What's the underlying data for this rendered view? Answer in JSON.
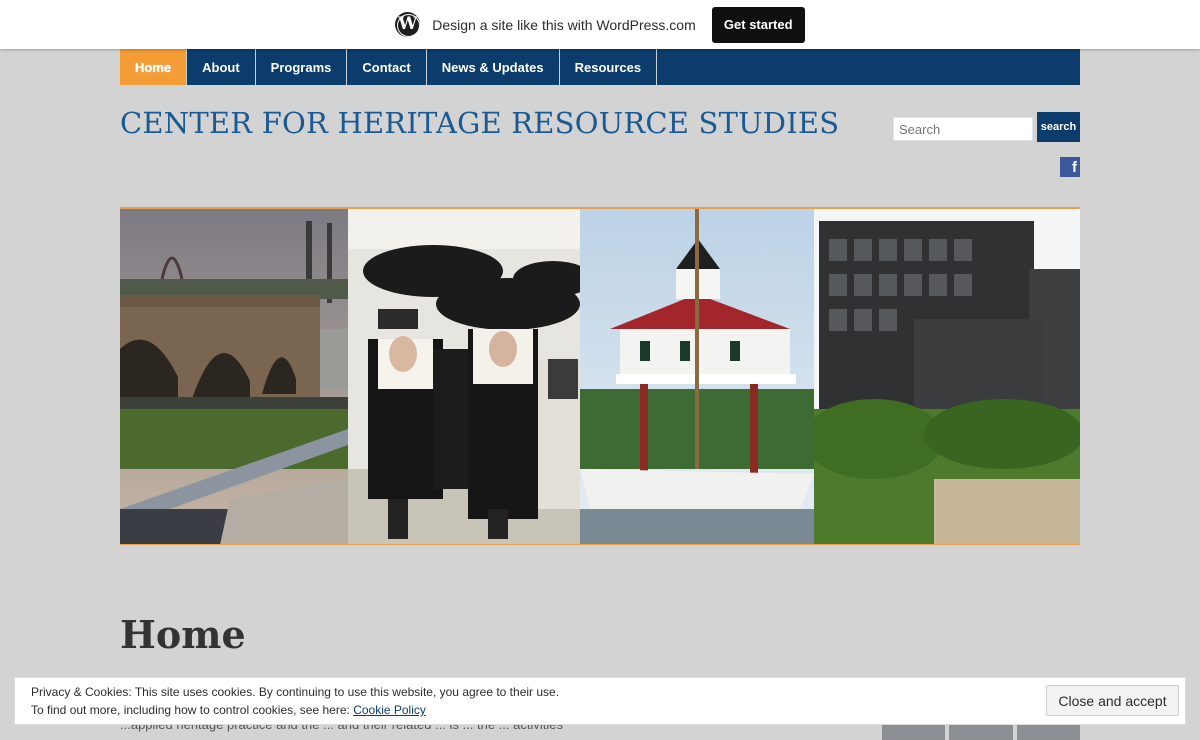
{
  "wp_banner": {
    "text": "Design a site like this with WordPress.com",
    "button": "Get started"
  },
  "nav": {
    "items": [
      {
        "label": "Home",
        "active": true
      },
      {
        "label": "About"
      },
      {
        "label": "Programs"
      },
      {
        "label": "Contact"
      },
      {
        "label": "News & Updates"
      },
      {
        "label": "Resources"
      }
    ]
  },
  "header": {
    "site_title": "CENTER FOR HERITAGE RESOURCE STUDIES",
    "search_placeholder": "Search",
    "search_button": "search",
    "social_icon": "facebook-icon"
  },
  "main": {
    "page_title": "Home",
    "body_text": "...applied heritage practice and the ... and their related ... is ... the ... activities"
  },
  "cookie_notice": {
    "line1": "Privacy & Cookies: This site uses cookies. By continuing to use this website, you agree to their use.",
    "line2_prefix": "To find out more, including how to control cookies, see here:",
    "link": "Cookie Policy",
    "button": "Close and accept"
  },
  "colors": {
    "nav_bg": "#0b3c6b",
    "nav_active": "#f49c36",
    "title": "#1a5a94",
    "page_bg": "#d3d3d3"
  }
}
